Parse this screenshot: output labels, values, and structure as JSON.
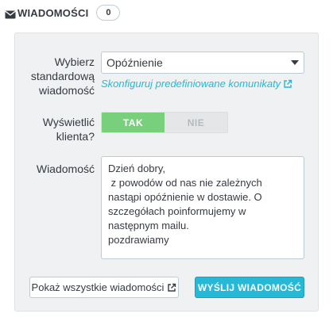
{
  "header": {
    "icon": "envelope-icon",
    "title": "WIADOMOŚCI",
    "count": "0"
  },
  "form": {
    "template_label_line1": "Wybierz",
    "template_label_line2": "standardową",
    "template_label_line3": "wiadomość",
    "template_selected": "Opóźnienie",
    "configure_link": "Skonfiguruj predefiniowane komunikaty",
    "show_customer_label_line1": "Wyświetlić",
    "show_customer_label_line2": "klienta?",
    "toggle_yes": "TAK",
    "toggle_no": "NIE",
    "toggle_value": "TAK",
    "message_label": "Wiadomość",
    "message_lines": [
      "Dzień dobry,",
      "",
      " z powodów od nas nie zależnych nastąpi opóźnienie w dostawie. O szczegółach poinformujemy w następnym mailu.",
      "",
      "pozdrawiamy"
    ]
  },
  "actions": {
    "show_all_label": "Pokaż wszystkie wiadomości",
    "send_label": "WYŚLIJ WIADOMOŚĆ"
  },
  "colors": {
    "accent": "#25b9d7",
    "toggle_on": "#78d07d",
    "panel_bg": "#eff1f2"
  }
}
